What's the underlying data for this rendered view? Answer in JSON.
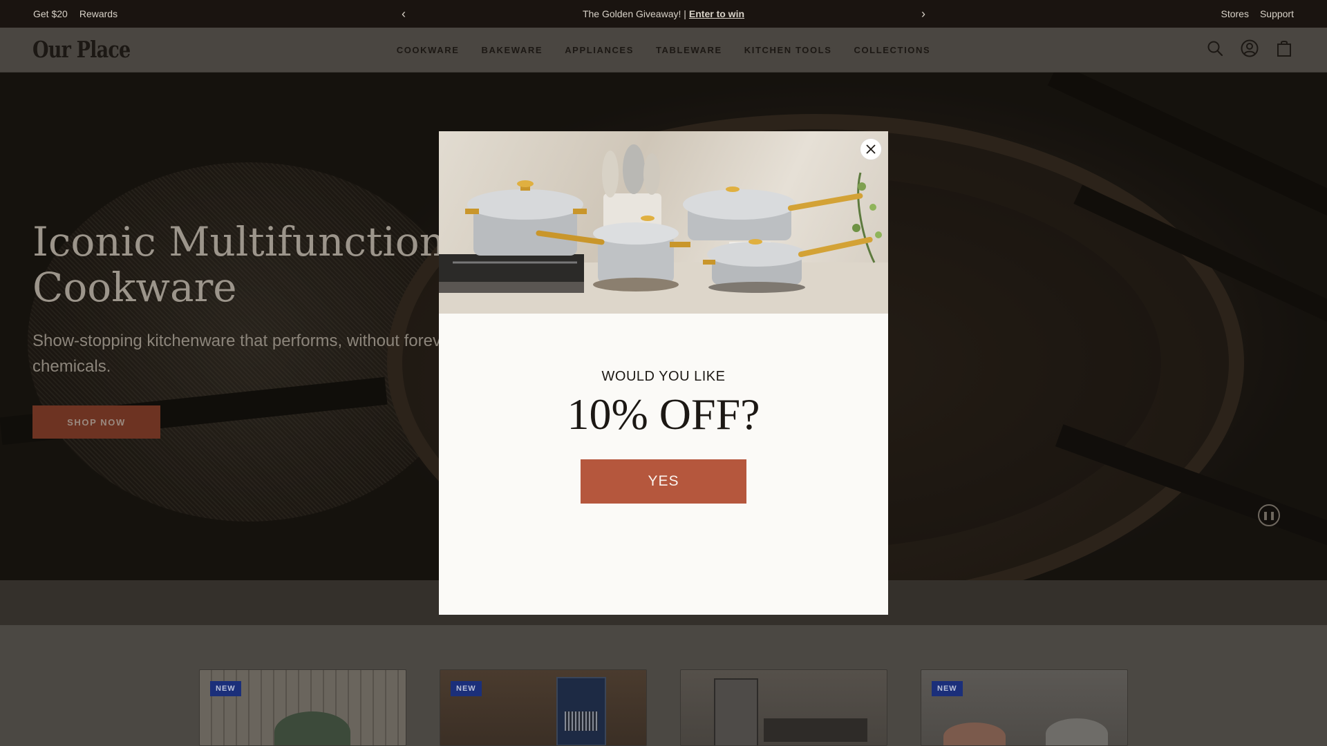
{
  "announcement": {
    "left_links": [
      "Get $20",
      "Rewards"
    ],
    "promo_text": "The Golden Giveaway! |",
    "promo_link": "Enter to win",
    "right_links": [
      "Stores",
      "Support"
    ]
  },
  "header": {
    "logo": "Our Place",
    "nav": [
      "COOKWARE",
      "BAKEWARE",
      "APPLIANCES",
      "TABLEWARE",
      "KITCHEN TOOLS",
      "COLLECTIONS"
    ]
  },
  "hero": {
    "title_line1": "Iconic Multifunctional",
    "title_line2": "Cookware",
    "subtitle": "Show-stopping kitchenware that performs, without forever chemicals.",
    "cta": "SHOP NOW"
  },
  "cards": [
    {
      "badge": "NEW"
    },
    {
      "badge": "NEW"
    },
    {
      "badge": ""
    },
    {
      "badge": "NEW"
    }
  ],
  "modal": {
    "kicker": "WOULD YOU LIKE",
    "title": "10% OFF?",
    "button": "YES"
  },
  "colors": {
    "modal_button": "#b5573d",
    "hero_button": "#6d3322",
    "badge": "#1b2f7a"
  }
}
